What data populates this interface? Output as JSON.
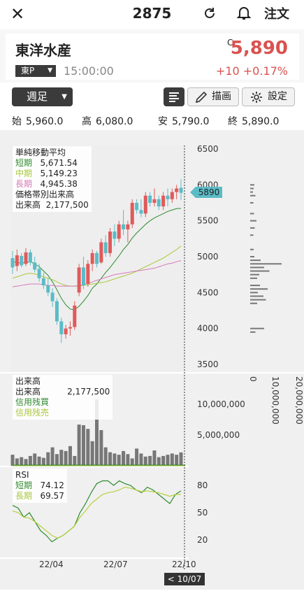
{
  "header": {
    "code": "2875",
    "order_label": "注文"
  },
  "stock": {
    "name": "東洋水産",
    "c_mark": "C",
    "price": "5,890",
    "exchange": "東P",
    "time": "15:00:00",
    "change": "+10",
    "change_pct": "+0.17%"
  },
  "toolbar": {
    "period": "週足",
    "draw_label": "描画",
    "settings_label": "設定"
  },
  "ohlc": {
    "open_label": "始",
    "open": "5,960.0",
    "high_label": "高",
    "high": "6,080.0",
    "low_label": "安",
    "low": "5,790.0",
    "close_label": "終",
    "close": "5,890.0"
  },
  "legend_ma": {
    "title": "単純移動平均",
    "short_label": "短期",
    "short": "5,671.54",
    "mid_label": "中期",
    "mid": "5,149.23",
    "long_label": "長期",
    "long": "4,945.38",
    "vp_title": "価格帯別出来高",
    "vol_label": "出来高",
    "vol": "2,177,500"
  },
  "legend_vol": {
    "title": "出来高",
    "vol_label": "出来高",
    "vol": "2,177,500",
    "margin_buy": "信用残買",
    "margin_sell": "信用残売"
  },
  "legend_rsi": {
    "title": "RSI",
    "short_label": "短期",
    "short": "74.12",
    "long_label": "長期",
    "long": "69.57"
  },
  "price_axis": [
    "6500",
    "6000",
    "5500",
    "5000",
    "4500",
    "4000",
    "3500"
  ],
  "vp_axis": [
    "0",
    "10,000,000",
    "20,000,000"
  ],
  "vol_axis": [
    "10,000,000",
    "5,000,000"
  ],
  "rsi_axis": [
    "80",
    "50",
    "20"
  ],
  "x_axis": [
    "22/04",
    "22/07",
    "22/10"
  ],
  "current_price_tag": "5890",
  "cursor_date": "< 10/07 >",
  "colors": {
    "up": "#e05a5a",
    "down": "#5bbcc7",
    "ma_short": "#2e8b2e",
    "ma_mid": "#a8c83a",
    "ma_long": "#d878b8",
    "rsi_short": "#2e8b2e",
    "rsi_long": "#b8d040",
    "volume": "#777777"
  },
  "chart_data": {
    "type": "candlestick",
    "candles": [
      {
        "o": 4980,
        "h": 5080,
        "l": 4760,
        "c": 4850
      },
      {
        "o": 4870,
        "h": 5100,
        "l": 4800,
        "c": 5020
      },
      {
        "o": 5010,
        "h": 5050,
        "l": 4850,
        "c": 4880
      },
      {
        "o": 4900,
        "h": 5120,
        "l": 4870,
        "c": 5060
      },
      {
        "o": 5060,
        "h": 5100,
        "l": 4880,
        "c": 4920
      },
      {
        "o": 4920,
        "h": 5000,
        "l": 4780,
        "c": 4820
      },
      {
        "o": 4830,
        "h": 4900,
        "l": 4650,
        "c": 4700
      },
      {
        "o": 4700,
        "h": 4780,
        "l": 4550,
        "c": 4600
      },
      {
        "o": 4600,
        "h": 4700,
        "l": 4450,
        "c": 4500
      },
      {
        "o": 4500,
        "h": 4560,
        "l": 4300,
        "c": 4380
      },
      {
        "o": 4380,
        "h": 4420,
        "l": 4050,
        "c": 4100
      },
      {
        "o": 4100,
        "h": 4150,
        "l": 3800,
        "c": 3920
      },
      {
        "o": 3920,
        "h": 4050,
        "l": 3860,
        "c": 4000
      },
      {
        "o": 4000,
        "h": 4100,
        "l": 3900,
        "c": 4020
      },
      {
        "o": 4020,
        "h": 4380,
        "l": 3980,
        "c": 4320
      },
      {
        "o": 4500,
        "h": 4900,
        "l": 4450,
        "c": 4850
      },
      {
        "o": 4850,
        "h": 5000,
        "l": 4550,
        "c": 4600
      },
      {
        "o": 4620,
        "h": 4950,
        "l": 4580,
        "c": 4900
      },
      {
        "o": 4900,
        "h": 5100,
        "l": 4800,
        "c": 5050
      },
      {
        "o": 5050,
        "h": 5080,
        "l": 4850,
        "c": 4900
      },
      {
        "o": 4920,
        "h": 5250,
        "l": 4900,
        "c": 5200
      },
      {
        "o": 5200,
        "h": 5300,
        "l": 5000,
        "c": 5050
      },
      {
        "o": 5050,
        "h": 5400,
        "l": 5000,
        "c": 5350
      },
      {
        "o": 5350,
        "h": 5450,
        "l": 5150,
        "c": 5250
      },
      {
        "o": 5250,
        "h": 5500,
        "l": 5200,
        "c": 5450
      },
      {
        "o": 5450,
        "h": 5650,
        "l": 5300,
        "c": 5380
      },
      {
        "o": 5380,
        "h": 5500,
        "l": 5200,
        "c": 5450
      },
      {
        "o": 5450,
        "h": 5800,
        "l": 5400,
        "c": 5750
      },
      {
        "o": 5750,
        "h": 5800,
        "l": 5600,
        "c": 5650
      },
      {
        "o": 5650,
        "h": 5800,
        "l": 5550,
        "c": 5600
      },
      {
        "o": 5600,
        "h": 5900,
        "l": 5550,
        "c": 5850
      },
      {
        "o": 5850,
        "h": 5900,
        "l": 5700,
        "c": 5750
      },
      {
        "o": 5750,
        "h": 5950,
        "l": 5700,
        "c": 5800
      },
      {
        "o": 5800,
        "h": 5850,
        "l": 5650,
        "c": 5700
      },
      {
        "o": 5700,
        "h": 5900,
        "l": 5650,
        "c": 5850
      },
      {
        "o": 5850,
        "h": 5950,
        "l": 5700,
        "c": 5800
      },
      {
        "o": 5800,
        "h": 5950,
        "l": 5750,
        "c": 5900
      },
      {
        "o": 5900,
        "h": 6000,
        "l": 5800,
        "c": 5950
      },
      {
        "o": 5960,
        "h": 6080,
        "l": 5790,
        "c": 5890
      }
    ],
    "ma_short": [
      4930,
      4920,
      4910,
      4920,
      4930,
      4900,
      4860,
      4800,
      4740,
      4650,
      4540,
      4420,
      4330,
      4270,
      4260,
      4310,
      4380,
      4460,
      4560,
      4620,
      4700,
      4780,
      4850,
      4930,
      5010,
      5100,
      5170,
      5260,
      5330,
      5390,
      5450,
      5500,
      5540,
      5570,
      5600,
      5630,
      5650,
      5670,
      5672
    ],
    "ma_mid": [
      4700,
      4720,
      4740,
      4760,
      4770,
      4760,
      4740,
      4720,
      4700,
      4680,
      4650,
      4620,
      4600,
      4590,
      4590,
      4590,
      4600,
      4610,
      4620,
      4630,
      4640,
      4650,
      4670,
      4690,
      4710,
      4730,
      4750,
      4770,
      4800,
      4830,
      4860,
      4890,
      4920,
      4950,
      4980,
      5020,
      5060,
      5100,
      5149
    ],
    "ma_long": [
      4580,
      4590,
      4600,
      4610,
      4620,
      4620,
      4620,
      4610,
      4600,
      4600,
      4590,
      4590,
      4590,
      4590,
      4590,
      4600,
      4610,
      4630,
      4650,
      4670,
      4690,
      4710,
      4730,
      4750,
      4760,
      4770,
      4780,
      4790,
      4800,
      4810,
      4820,
      4830,
      4840,
      4860,
      4880,
      4900,
      4910,
      4930,
      4945
    ],
    "volume_m": [
      1.8,
      1.2,
      1.4,
      1.1,
      1.6,
      2.0,
      1.5,
      1.3,
      2.2,
      3.0,
      1.9,
      2.6,
      2.4,
      3.2,
      1.6,
      6.7,
      6.6,
      6.0,
      4.0,
      10.8,
      5.8,
      3.0,
      2.2,
      2.0,
      1.8,
      2.4,
      1.9,
      1.2,
      2.8,
      2.0,
      1.5,
      1.6,
      2.5,
      1.4,
      1.6,
      1.8,
      2.0,
      1.8,
      2.18
    ],
    "rsi_short": [
      58,
      55,
      45,
      50,
      40,
      30,
      25,
      18,
      22,
      25,
      30,
      35,
      50,
      60,
      72,
      82,
      85,
      85,
      80,
      85,
      82,
      80,
      75,
      72,
      78,
      75,
      70,
      65,
      60,
      70,
      74
    ],
    "rsi_long": [
      52,
      50,
      45,
      44,
      40,
      35,
      30,
      25,
      22,
      25,
      30,
      35,
      45,
      52,
      60,
      65,
      70,
      72,
      73,
      75,
      78,
      77,
      75,
      73,
      74,
      73,
      72,
      70,
      68,
      70,
      70
    ],
    "volume_by_price": [
      {
        "price": 6000,
        "v": 1.2
      },
      {
        "price": 5950,
        "v": 1.0
      },
      {
        "price": 5900,
        "v": 0.8
      },
      {
        "price": 5850,
        "v": 1.5
      },
      {
        "price": 5750,
        "v": 0.9
      },
      {
        "price": 5600,
        "v": 1.1
      },
      {
        "price": 5500,
        "v": 1.8
      },
      {
        "price": 5400,
        "v": 1.3
      },
      {
        "price": 5300,
        "v": 0.9
      },
      {
        "price": 5100,
        "v": 1.0
      },
      {
        "price": 5000,
        "v": 1.2
      },
      {
        "price": 4950,
        "v": 3.0
      },
      {
        "price": 4900,
        "v": 9.0
      },
      {
        "price": 4850,
        "v": 4.0
      },
      {
        "price": 4800,
        "v": 5.5
      },
      {
        "price": 4750,
        "v": 2.6
      },
      {
        "price": 4700,
        "v": 2.0
      },
      {
        "price": 4600,
        "v": 2.8
      },
      {
        "price": 4550,
        "v": 5.0
      },
      {
        "price": 4500,
        "v": 2.2
      },
      {
        "price": 4450,
        "v": 3.8
      },
      {
        "price": 4400,
        "v": 4.5
      },
      {
        "price": 4350,
        "v": 2.0
      },
      {
        "price": 4000,
        "v": 4.0
      },
      {
        "price": 3950,
        "v": 1.5
      }
    ],
    "price_range": [
      3500,
      6500
    ],
    "rsi_range": [
      0,
      100
    ]
  }
}
